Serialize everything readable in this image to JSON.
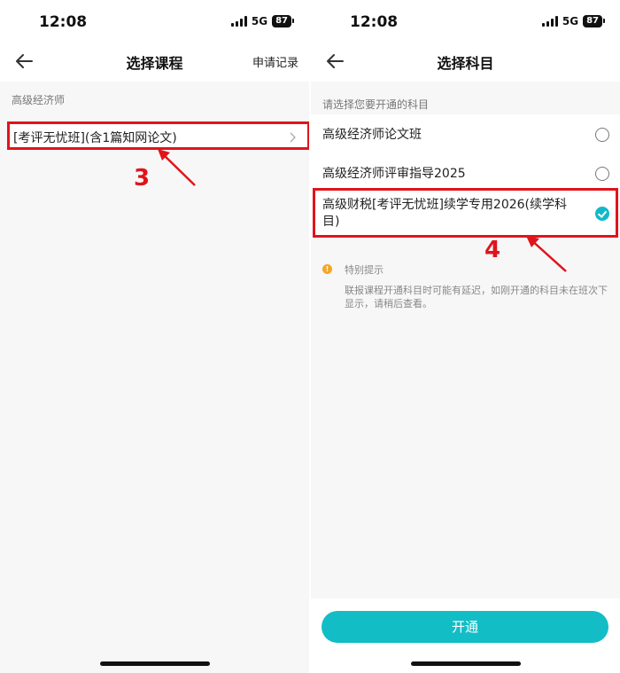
{
  "status": {
    "time": "12:08",
    "network": "5G",
    "battery": "87"
  },
  "left": {
    "title": "选择课程",
    "action": "申请记录",
    "section_label": "高级经济师",
    "course_item": "[考评无忧班](含1篇知网论文)",
    "annotation_step": "3"
  },
  "right": {
    "title": "选择科目",
    "prompt": "请选择您要开通的科目",
    "subjects": [
      {
        "label": "高级经济师论文班",
        "selected": false
      },
      {
        "label": "高级经济师评审指导2025",
        "selected": false
      },
      {
        "label": "高级财税[考评无忧班]续学专用2026(续学科目)",
        "selected": true
      }
    ],
    "annotation_step": "4",
    "tip_title": "特别提示",
    "tip_text": "联报课程开通科目时可能有延迟，如刚开通的科目未在班次下显示，请稍后查看。",
    "open_button": "开通"
  },
  "colors": {
    "accent": "#12bdc6",
    "annotation_red": "#e0141b",
    "tip_orange": "#f5a623"
  },
  "icons": [
    "back-arrow-icon",
    "chevron-right-icon",
    "radio-unchecked-icon",
    "radio-checked-icon",
    "info-icon",
    "signal-icon",
    "battery-icon"
  ]
}
